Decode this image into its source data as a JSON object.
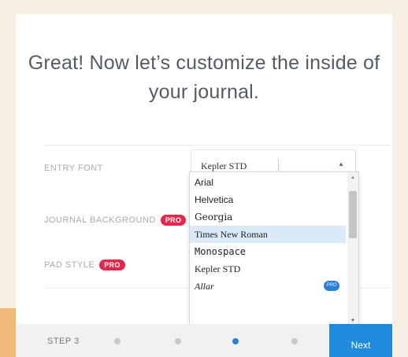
{
  "headline": "Great! Now let’s customize the inside of your journal.",
  "rows": [
    {
      "label": "ENTRY FONT",
      "pro": ""
    },
    {
      "label": "JOURNAL BACKGROUND",
      "pro": "PRO"
    },
    {
      "label": "PAD STYLE",
      "pro": "PRO"
    }
  ],
  "entry_font": {
    "selected": "Kepler STD",
    "options": [
      {
        "label": "Arial",
        "pro": ""
      },
      {
        "label": "Helvetica",
        "pro": ""
      },
      {
        "label": "Georgia",
        "pro": ""
      },
      {
        "label": "Times New Roman",
        "pro": ""
      },
      {
        "label": "Monospace",
        "pro": ""
      },
      {
        "label": "Kepler STD",
        "pro": ""
      },
      {
        "label": "Allar",
        "pro": "PRO"
      }
    ],
    "highlighted_index": 3
  },
  "footer": {
    "step_label": "STEP 3",
    "steps_total": 4,
    "current_step": 3,
    "next_label": "Next"
  },
  "colors": {
    "accent_blue": "#1f8bdc",
    "pro_red": "#e0294b",
    "background": "#f8efe4"
  }
}
